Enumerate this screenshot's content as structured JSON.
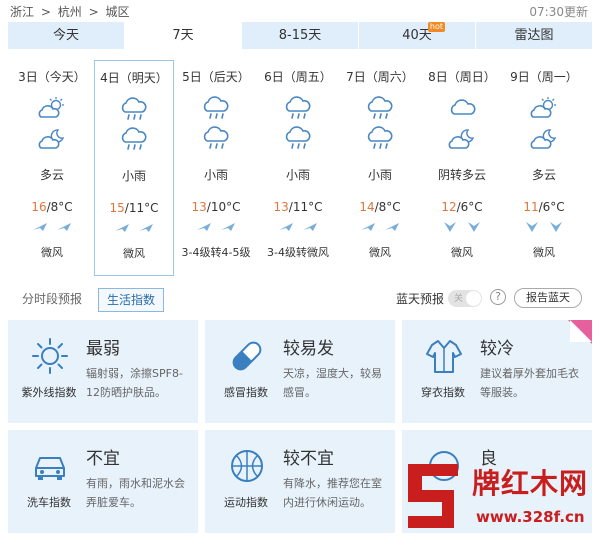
{
  "breadcrumb": [
    "浙江",
    ">",
    "杭州",
    ">",
    "城区"
  ],
  "update_time": "07:30更新",
  "tabs": [
    {
      "label": "今天"
    },
    {
      "label": "7天",
      "active": true
    },
    {
      "label": "8-15天"
    },
    {
      "label": "40天",
      "badge": "hot"
    },
    {
      "label": "雷达图"
    }
  ],
  "days": [
    {
      "date": "3日（今天）",
      "icon_day": "partly-cloudy-icon",
      "icon_night": "partly-cloudy-night-icon",
      "desc": "多云",
      "high": "16",
      "low": "/8°C",
      "wind": "微风"
    },
    {
      "date": "4日（明天）",
      "icon_day": "rain-icon",
      "icon_night": "rain-icon",
      "desc": "小雨",
      "high": "15",
      "low": "/11°C",
      "wind": "微风",
      "selected": true
    },
    {
      "date": "5日（后天）",
      "icon_day": "rain-icon",
      "icon_night": "rain-icon",
      "desc": "小雨",
      "high": "13",
      "low": "/10°C",
      "wind": "3-4级转4-5级"
    },
    {
      "date": "6日（周五）",
      "icon_day": "rain-icon",
      "icon_night": "rain-icon",
      "desc": "小雨",
      "high": "13",
      "low": "/11°C",
      "wind": "3-4级转微风"
    },
    {
      "date": "7日（周六）",
      "icon_day": "rain-icon",
      "icon_night": "rain-icon",
      "desc": "小雨",
      "high": "14",
      "low": "/8°C",
      "wind": "微风"
    },
    {
      "date": "8日（周日）",
      "icon_day": "cloudy-icon",
      "icon_night": "partly-cloudy-night-icon",
      "desc": "阴转多云",
      "high": "12",
      "low": "/6°C",
      "wind": "微风"
    },
    {
      "date": "9日（周一）",
      "icon_day": "partly-cloudy-icon",
      "icon_night": "partly-cloudy-night-icon",
      "desc": "多云",
      "high": "11",
      "low": "/6°C",
      "wind": "微风"
    }
  ],
  "subtabs": {
    "hourly": "分时段预报",
    "life": "生活指数"
  },
  "bluesky": {
    "label": "蓝天预报",
    "toggle": "关",
    "help": "?",
    "report": "报告蓝天"
  },
  "indices": [
    {
      "icon": "sun-uv-icon",
      "label": "紫外线指数",
      "level": "最弱",
      "desc": "辐射弱，涂擦SPF8-12防晒护肤品。"
    },
    {
      "icon": "pill-icon",
      "label": "感冒指数",
      "level": "较易发",
      "desc": "天凉，湿度大，较易感冒。"
    },
    {
      "icon": "clothes-icon",
      "label": "穿衣指数",
      "level": "较冷",
      "desc": "建议着厚外套加毛衣等服装。"
    },
    {
      "icon": "car-wash-icon",
      "label": "洗车指数",
      "level": "不宜",
      "desc": "有雨，雨水和泥水会弄脏爱车。"
    },
    {
      "icon": "ball-icon",
      "label": "运动指数",
      "level": "较不宜",
      "desc": "有降水，推荐您在室内进行休闲运动。"
    },
    {
      "icon": "air-quality-icon",
      "label": "",
      "level": "良",
      "desc": ""
    }
  ],
  "watermark": {
    "brand": "牌红木网",
    "url": "www.328f.cn"
  },
  "colors": {
    "tab_bg": "#dfeefa",
    "card_bg": "#e8f2fb",
    "high_temp": "#e0763d",
    "accent_blue": "#2a6ca8",
    "watermark_red": "#c81e1e",
    "corner_pink": "#e6609e"
  }
}
